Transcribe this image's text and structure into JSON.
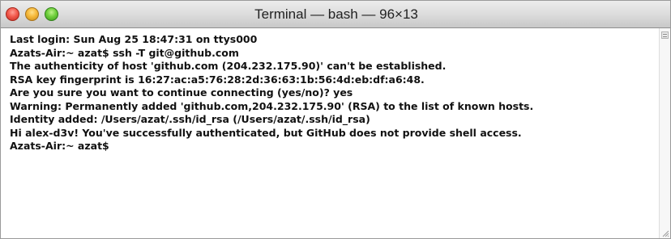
{
  "window": {
    "title": "Terminal — bash — 96×13"
  },
  "terminal": {
    "lines": [
      "Last login: Sun Aug 25 18:47:31 on ttys000",
      "Azats-Air:~ azat$ ssh -T git@github.com",
      "The authenticity of host 'github.com (204.232.175.90)' can't be established.",
      "RSA key fingerprint is 16:27:ac:a5:76:28:2d:36:63:1b:56:4d:eb:df:a6:48.",
      "Are you sure you want to continue connecting (yes/no)? yes",
      "Warning: Permanently added 'github.com,204.232.175.90' (RSA) to the list of known hosts.",
      "Identity added: /Users/azat/.ssh/id_rsa (/Users/azat/.ssh/id_rsa)",
      "Hi alex-d3v! You've successfully authenticated, but GitHub does not provide shell access.",
      "Azats-Air:~ azat$"
    ]
  },
  "icons": {
    "close": "close-button",
    "minimize": "minimize-button",
    "zoom": "zoom-button",
    "scrollbar_toggle": "scrollbar-toggle-icon",
    "resize": "resize-grip-icon"
  },
  "colors": {
    "close": "#f25a4d",
    "minimize": "#f6b93a",
    "zoom": "#6fcf3c",
    "text": "#111111",
    "background": "#ffffff"
  }
}
